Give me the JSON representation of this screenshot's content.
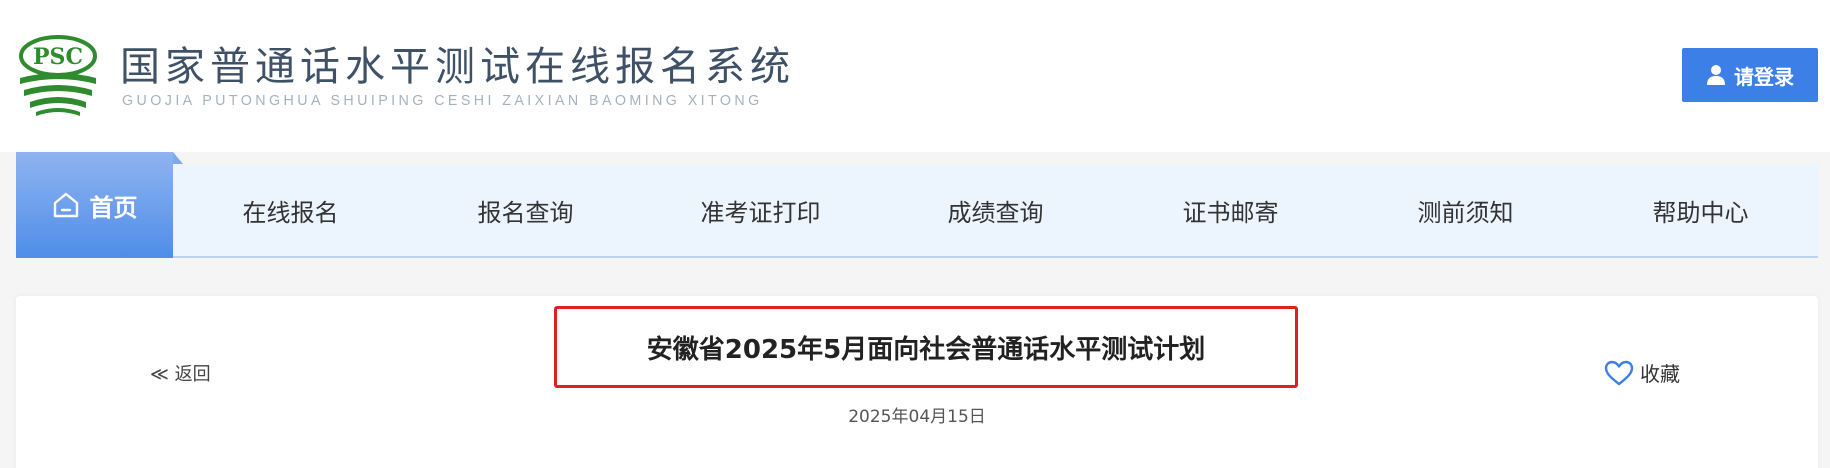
{
  "header": {
    "logo_text": "PSC",
    "title": "国家普通话水平测试在线报名系统",
    "subtitle": "GUOJIA PUTONGHUA SHUIPING CESHI ZAIXIAN BAOMING XITONG",
    "login_label": "请登录",
    "login_icon": "user-icon"
  },
  "nav": {
    "home_label": "首页",
    "home_icon": "home-icon",
    "items": [
      "在线报名",
      "报名查询",
      "准考证打印",
      "成绩查询",
      "证书邮寄",
      "测前须知",
      "帮助中心"
    ]
  },
  "article": {
    "back_label": "≪ 返回",
    "title": "安徽省2025年5月面向社会普通话水平测试计划",
    "date": "2025年04月15日",
    "favorite_label": "收藏",
    "favorite_icon": "heart-icon"
  },
  "colors": {
    "brand_green": "#2e8b2e",
    "primary_blue": "#3b7fe7",
    "highlight_red": "#e02020"
  }
}
